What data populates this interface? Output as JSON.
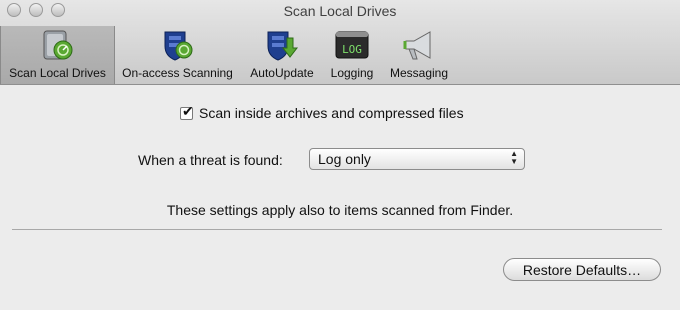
{
  "window": {
    "title": "Scan Local Drives"
  },
  "toolbar": {
    "items": [
      {
        "label": "Scan Local Drives",
        "icon": "hard-drive-scan-icon",
        "selected": true
      },
      {
        "label": "On-access Scanning",
        "icon": "shield-scan-icon",
        "selected": false
      },
      {
        "label": "AutoUpdate",
        "icon": "shield-download-icon",
        "selected": false
      },
      {
        "label": "Logging",
        "icon": "log-terminal-icon",
        "selected": false
      },
      {
        "label": "Messaging",
        "icon": "megaphone-icon",
        "selected": false
      }
    ],
    "log_icon_text": "LOG"
  },
  "settings": {
    "scan_archives": {
      "label": "Scan inside archives and compressed files",
      "checked": true
    },
    "threat_action": {
      "label": "When a threat is found:",
      "value": "Log only"
    },
    "note": "These settings apply also to items scanned from Finder.",
    "restore_label": "Restore Defaults…"
  },
  "colors": {
    "accent_green": "#5aa832",
    "shield_blue": "#1f3f8f"
  }
}
